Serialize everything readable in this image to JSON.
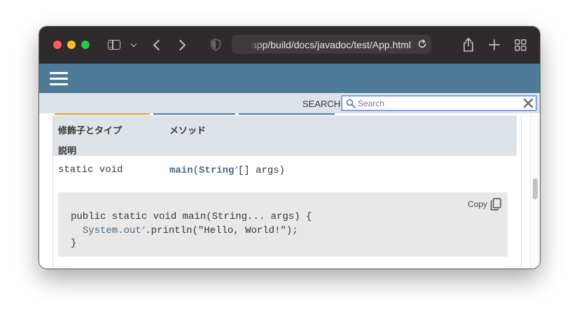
{
  "browser": {
    "url": "app/build/docs/javadoc/test/App.html"
  },
  "javadoc": {
    "search": {
      "label": "SEARCH:",
      "placeholder": "Search"
    },
    "table": {
      "header_modifier": "修飾子とタイプ",
      "header_method": "メソッド",
      "header_description": "説明",
      "rows": [
        {
          "modifier": "static void",
          "method_name": "main",
          "method_paren_open": "(",
          "param_type": "String",
          "method_rest": "[] args)"
        }
      ]
    },
    "code_block": {
      "copy_label": "Copy",
      "line1": "public static void main(String... args) {",
      "line2_indent": "  ",
      "line2_link": "System.out",
      "line2_rest": ".println(\"Hello, World!\");",
      "line3": "}"
    }
  },
  "colors": {
    "nav_bar": "#4d7a97",
    "sub_nav": "#dee3e9",
    "active_tab": "#f8981d",
    "link": "#4a6782",
    "code_bg": "#e8e8e8"
  },
  "icons": {
    "external_link": "↗"
  }
}
